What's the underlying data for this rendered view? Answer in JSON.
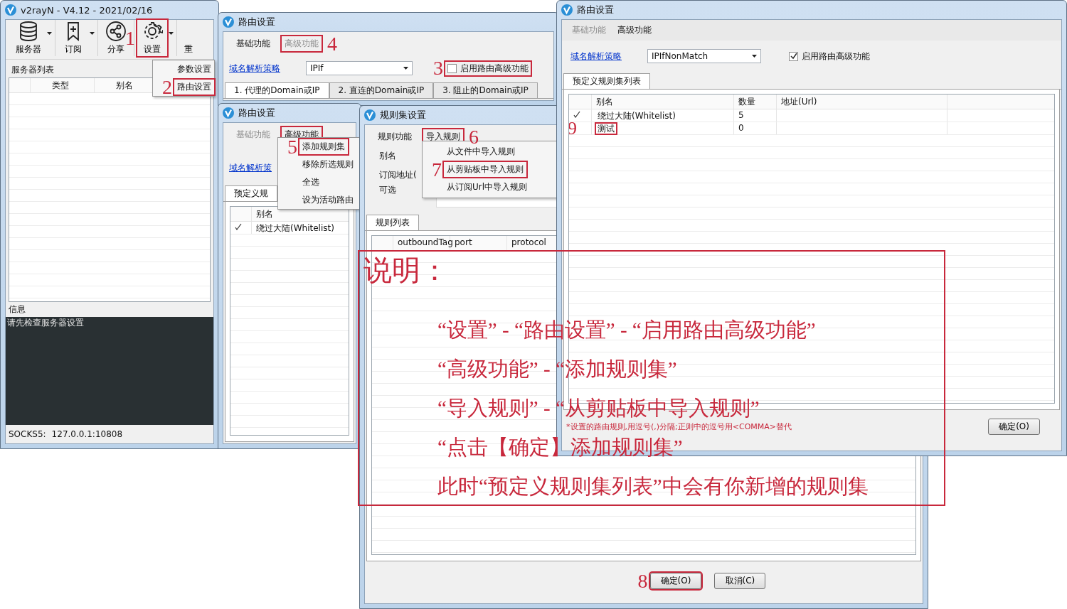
{
  "main_window": {
    "title": "v2rayN - V4.12 - 2021/02/16",
    "toolbar": [
      {
        "label": "服务器",
        "kind": "database",
        "dropdown": true,
        "highlighted": false
      },
      {
        "label": "订阅",
        "kind": "bookmark",
        "dropdown": true,
        "highlighted": false
      },
      {
        "label": "分享",
        "kind": "share",
        "dropdown": false,
        "highlighted": false
      },
      {
        "label": "设置",
        "kind": "gear",
        "dropdown": true,
        "highlighted": true,
        "step": "1"
      },
      {
        "label": "重",
        "kind": "none",
        "dropdown": false,
        "highlighted": false
      }
    ],
    "settings_menu": [
      {
        "label": "参数设置",
        "highlighted": false
      },
      {
        "label": "路由设置",
        "highlighted": true,
        "step": "2"
      }
    ],
    "server_list": {
      "title": "服务器列表",
      "columns": [
        "类型",
        "别名"
      ]
    },
    "info": {
      "title": "信息",
      "log": "请先检查服务器设置"
    },
    "status_bar": {
      "label": "SOCKS5:",
      "value": "127.0.0.1:10808"
    }
  },
  "routing_window_back": {
    "title": "路由设置",
    "menubar": [
      {
        "label": "基础功能",
        "disabled": false,
        "highlighted": false
      },
      {
        "label": "高级功能",
        "disabled": true,
        "highlighted": true,
        "step": "4"
      }
    ],
    "link": "域名解析策略",
    "select": "IPIf",
    "checkbox": {
      "label": "启用路由高级功能",
      "checked": false,
      "highlighted": true,
      "step": "3"
    },
    "rule_tabs": [
      {
        "label": "1. 代理的Domain或IP",
        "selected": true
      },
      {
        "label": "2. 直连的Domain或IP",
        "selected": false
      },
      {
        "label": "3. 阻止的Domain或IP",
        "selected": false
      }
    ]
  },
  "routing_window_middle": {
    "title": "路由设置",
    "menubar": [
      {
        "label": "基础功能",
        "disabled": true,
        "highlighted": false
      },
      {
        "label": "高级功能",
        "disabled": false,
        "highlighted": true
      }
    ],
    "menu": [
      {
        "label": "添加规则集",
        "highlighted": true,
        "step": "5"
      },
      {
        "label": "移除所选规则",
        "highlighted": false
      },
      {
        "label": "全选",
        "highlighted": false
      },
      {
        "label": "设为活动路由",
        "highlighted": false
      }
    ],
    "link": "域名解析策",
    "tab": "预定义规",
    "column": "别名",
    "rows": [
      {
        "checked": true,
        "name": "绕过大陆(Whitelist)"
      }
    ]
  },
  "ruleset_window": {
    "title": "规则集设置",
    "menubar": [
      {
        "label": "规则功能",
        "highlighted": false
      },
      {
        "label": "导入规则",
        "highlighted": true,
        "step": "6"
      }
    ],
    "menu": [
      {
        "label": "从文件中导入规则",
        "highlighted": false
      },
      {
        "label": "从剪贴板中导入规则",
        "highlighted": true,
        "step": "7"
      },
      {
        "label": "从订阅Url中导入规则",
        "highlighted": false
      }
    ],
    "alias_label": "别名",
    "url_label": "订阅地址(",
    "optional_label": "可选",
    "tab": "规则列表",
    "columns": [
      "outboundTag",
      "port",
      "protocol"
    ],
    "buttons": [
      {
        "label": "确定(O)",
        "highlighted": true,
        "step": "8"
      },
      {
        "label": "取消(C)",
        "highlighted": false
      }
    ]
  },
  "routing_window_front": {
    "title": "路由设置",
    "menubar": [
      {
        "label": "基础功能",
        "disabled": true
      },
      {
        "label": "高级功能",
        "disabled": false
      }
    ],
    "link": "域名解析策略",
    "select": "IPIfNonMatch",
    "checkbox": {
      "label": "启用路由高级功能",
      "checked": true
    },
    "tab": "预定义规则集列表",
    "columns": [
      "别名",
      "数量",
      "地址(Url)"
    ],
    "rows": [
      {
        "checked": true,
        "name": "绕过大陆(Whitelist)",
        "count": "5",
        "highlighted": false
      },
      {
        "checked": false,
        "name": "测试",
        "count": "0",
        "highlighted": true,
        "step": "9"
      }
    ],
    "note": "*设置的路由规则,用逗号(,)分隔;正则中的逗号用<COMMA>替代",
    "button": "确定(O)"
  },
  "explanation": {
    "title": "说明：",
    "lines": [
      "“设置” - “路由设置” - “启用路由高级功能”",
      "“高级功能” - “添加规则集”",
      "“导入规则” - “从剪贴板中导入规则”",
      "“点击【确定】添加规则集”",
      "此时“预定义规则集列表”中会有你新增的规则集"
    ]
  }
}
